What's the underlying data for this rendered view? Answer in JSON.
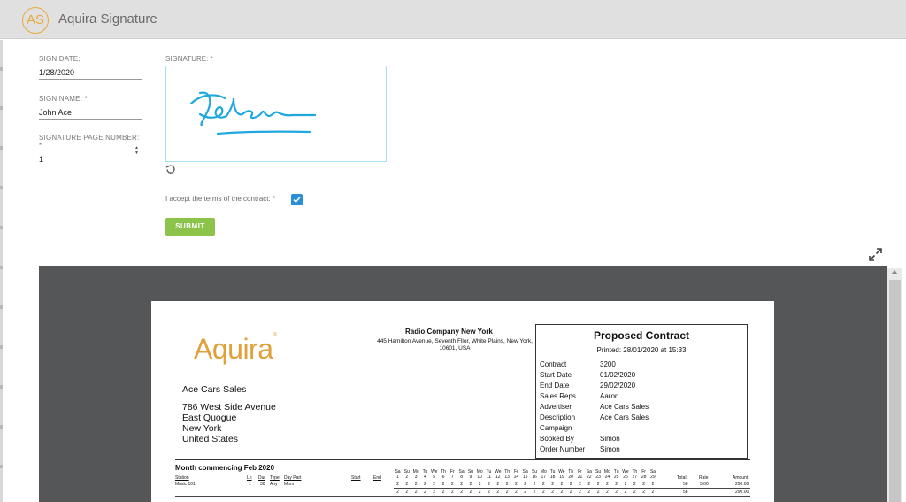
{
  "header": {
    "logo_text": "AS",
    "title": "Aquira Signature"
  },
  "form": {
    "sign_date": {
      "label": "SIGN DATE:",
      "value": "1/28/2020"
    },
    "sign_name": {
      "label": "SIGN NAME: *",
      "value": "John Ace"
    },
    "page_number": {
      "label": "SIGNATURE PAGE NUMBER: *",
      "value": "1"
    },
    "signature_label": "SIGNATURE: *",
    "accept_label": "I accept the terms of the contract: *",
    "accept_checked": true,
    "submit_label": "SUBMIT"
  },
  "document": {
    "logo_text": "Aquira",
    "logo_mark": "®",
    "company": {
      "name": "Radio Company New York",
      "address": "445 Hamilton Avenue, Seventh Fllor, White Plains, New York, 10601, USA"
    },
    "customer": {
      "name": "Ace Cars Sales",
      "address_lines": [
        "786 West Side Avenue",
        "East Quogue",
        "New York",
        "United States"
      ]
    },
    "contract": {
      "title": "Proposed Contract",
      "printed": "Printed: 28/01/2020 at 15:33",
      "rows": [
        {
          "key": "Contract",
          "value": "3200"
        },
        {
          "key": "Start Date",
          "value": "01/02/2020"
        },
        {
          "key": "End Date",
          "value": "29/02/2020"
        },
        {
          "key": "Sales Reps",
          "value": "Aaron"
        },
        {
          "key": "Advertiser",
          "value": "Ace Cars Sales"
        },
        {
          "key": "Description",
          "value": "Ace Cars Sales"
        },
        {
          "key": "Campaign",
          "value": ""
        },
        {
          "key": "Booked By",
          "value": "Simon"
        },
        {
          "key": "Order Number",
          "value": "Simon"
        }
      ]
    },
    "schedule": {
      "month_label": "Month commencing   Feb 2020",
      "headers": {
        "station": "Station",
        "ln": "Ln",
        "dur": "Dur",
        "type": "Type",
        "daypart": "Day Part",
        "start": "Start",
        "end": "End",
        "total": "Total",
        "rate": "Rate",
        "amount": "Amount"
      },
      "day_names": [
        "Sa",
        "Su",
        "Mo",
        "Tu",
        "We",
        "Th",
        "Fr",
        "Sa",
        "Su",
        "Mo",
        "Tu",
        "We",
        "Th",
        "Fr",
        "Sa",
        "Su",
        "Mo",
        "Tu",
        "We",
        "Th",
        "Fr",
        "Sa",
        "Su",
        "Mo",
        "Tu",
        "We",
        "Th",
        "Fr",
        "Sa"
      ],
      "day_numbers": [
        "1",
        "2",
        "3",
        "4",
        "5",
        "6",
        "7",
        "8",
        "9",
        "10",
        "11",
        "12",
        "13",
        "14",
        "15",
        "16",
        "17",
        "18",
        "19",
        "20",
        "21",
        "22",
        "23",
        "24",
        "25",
        "26",
        "27",
        "28",
        "29"
      ],
      "row": {
        "station": "Music 101",
        "ln": "1",
        "dur": "30",
        "type": "Any",
        "daypart": "Mom",
        "total": "58",
        "rate": "5.00",
        "amount": "290.00"
      },
      "spot_value": "2",
      "total_row": {
        "total": "58",
        "amount": "290.00"
      }
    }
  }
}
